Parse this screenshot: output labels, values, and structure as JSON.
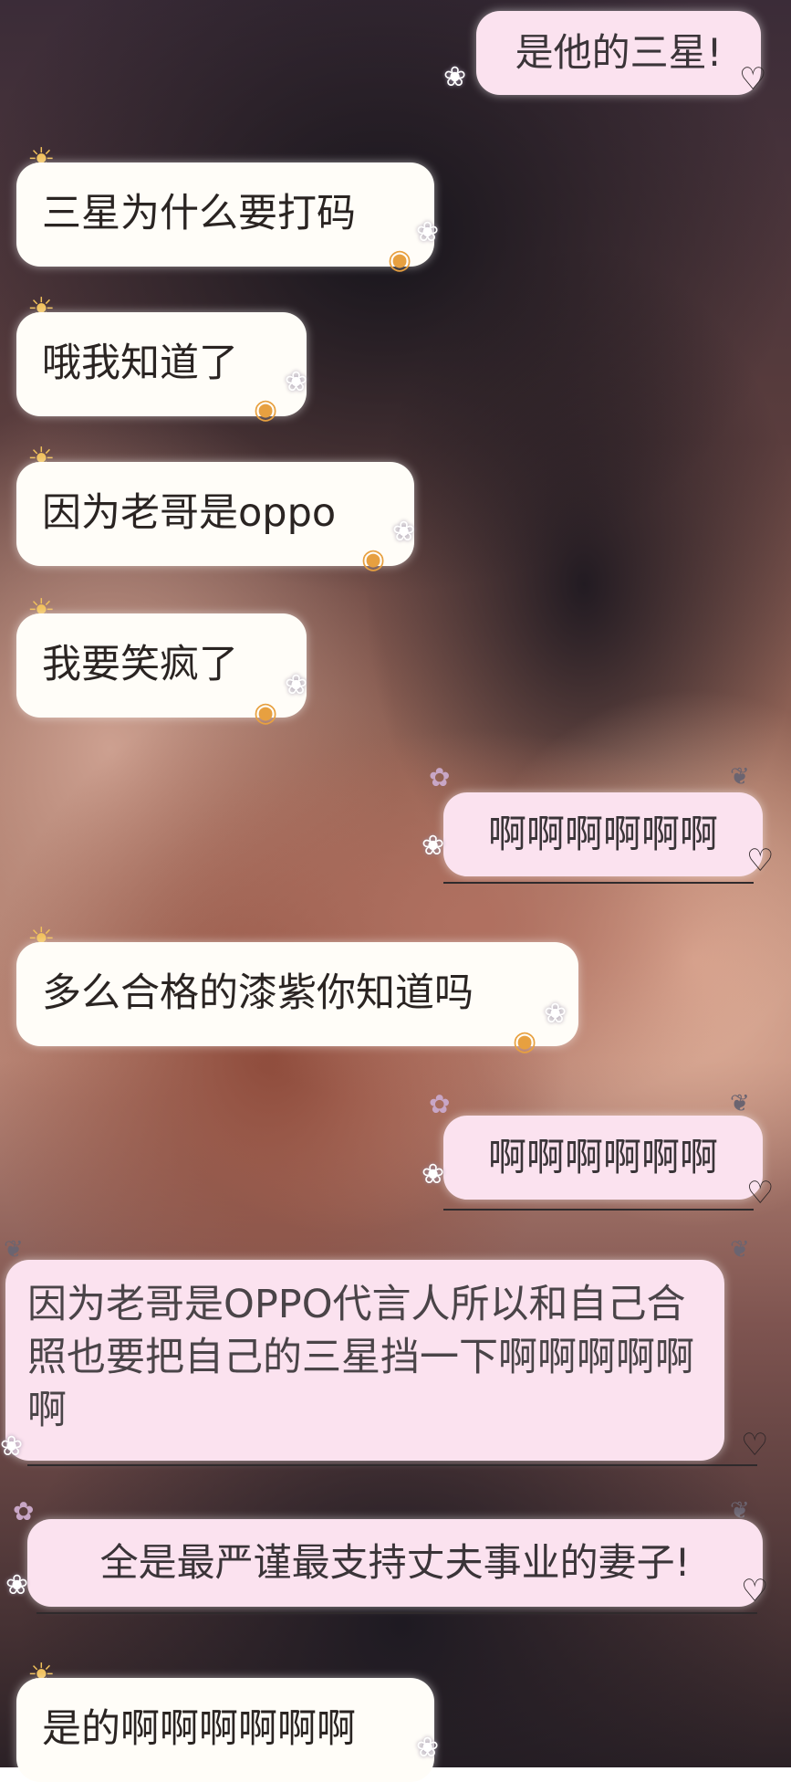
{
  "messages": [
    {
      "text": "是他的三星!"
    },
    {
      "text": "三星为什么要打码"
    },
    {
      "text": "哦我知道了"
    },
    {
      "text": "因为老哥是oppo"
    },
    {
      "text": "我要笑疯了"
    },
    {
      "text": "啊啊啊啊啊啊"
    },
    {
      "text": "多么合格的漆紫你知道吗"
    },
    {
      "text": "啊啊啊啊啊啊"
    },
    {
      "text": "因为老哥是OPPO代言人所以和自己合照也要把自己的三星挡一下啊啊啊啊啊啊"
    },
    {
      "text": "全是最严谨最支持丈夫事业的妻子!"
    },
    {
      "text": "是的啊啊啊啊啊啊"
    }
  ],
  "icons": {
    "sun": "sun-icon",
    "mooncake": "mooncake-icon",
    "bunny": "bunny-icon",
    "flower": "flower-icon",
    "heart": "heart-icon",
    "butterfly": "butterfly-icon"
  },
  "colors": {
    "left_bubble": "#fffdf8",
    "right_bubble": "#fbe2ef",
    "text": "#2a2422"
  }
}
